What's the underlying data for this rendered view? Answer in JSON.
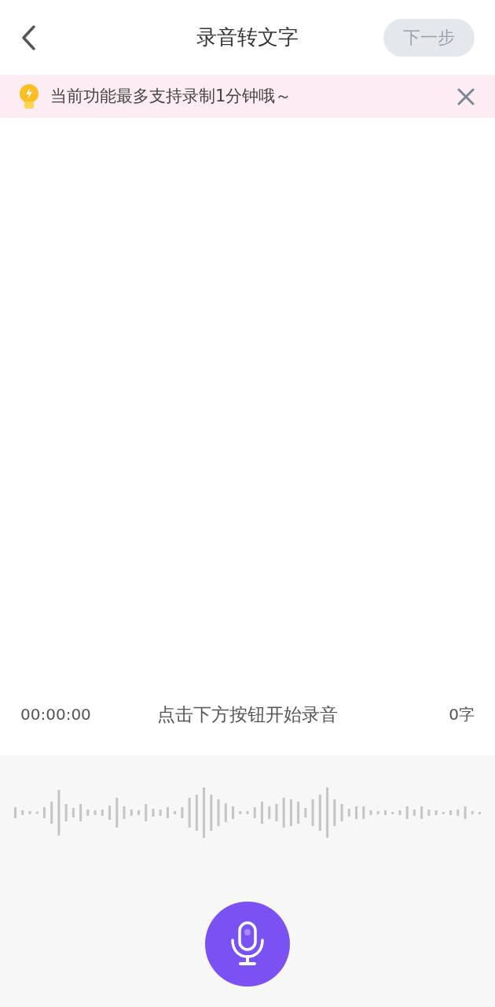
{
  "header": {
    "title": "录音转文字",
    "next_button": {
      "label": "下一步",
      "disabled": true
    }
  },
  "notice": {
    "text": "当前功能最多支持录制1分钟哦～"
  },
  "status": {
    "time": "00:00:00",
    "hint": "点击下方按钮开始录音",
    "count": "0字"
  }
}
